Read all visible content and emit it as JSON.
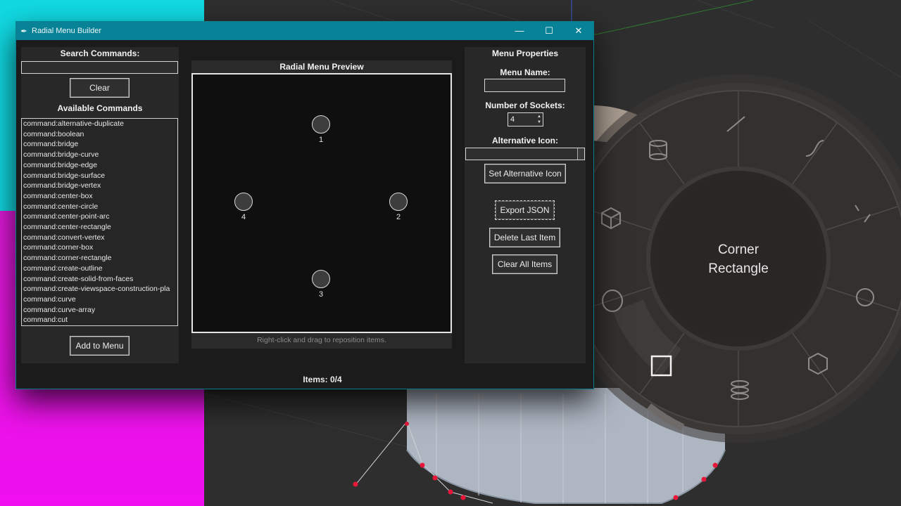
{
  "window": {
    "title": "Radial Menu Builder",
    "controls": {
      "minimize": "—",
      "maximize": "☐",
      "close": "✕"
    }
  },
  "left": {
    "search_label": "Search Commands:",
    "search_value": "",
    "clear_label": "Clear",
    "available_label": "Available Commands",
    "commands": [
      "command:alternative-duplicate",
      "command:boolean",
      "command:bridge",
      "command:bridge-curve",
      "command:bridge-edge",
      "command:bridge-surface",
      "command:bridge-vertex",
      "command:center-box",
      "command:center-circle",
      "command:center-point-arc",
      "command:center-rectangle",
      "command:convert-vertex",
      "command:corner-box",
      "command:corner-rectangle",
      "command:create-outline",
      "command:create-solid-from-faces",
      "command:create-viewspace-construction-pla",
      "command:curve",
      "command:curve-array",
      "command:cut"
    ],
    "add_label": "Add to Menu"
  },
  "center": {
    "preview_label": "Radial Menu Preview",
    "sockets": [
      "1",
      "2",
      "3",
      "4"
    ],
    "hint": "Right-click and drag to reposition items."
  },
  "right": {
    "properties_label": "Menu Properties",
    "menu_name_label": "Menu Name:",
    "menu_name_value": "",
    "sockets_label": "Number of Sockets:",
    "sockets_value": "4",
    "alt_icon_label": "Alternative Icon:",
    "alt_icon_value": "",
    "set_alt_icon_label": "Set Alternative Icon",
    "export_label": "Export JSON",
    "delete_last_label": "Delete Last Item",
    "clear_all_label": "Clear All Items"
  },
  "status": {
    "items": "Items: 0/4"
  },
  "radial_menu": {
    "center_line1": "Corner",
    "center_line2": "Rectangle",
    "icons": [
      "line-icon",
      "curve-icon",
      "bridge-curve-icon",
      "circle-point-icon",
      "hexagon-icon",
      "stack-icon",
      "corner-rectangle-icon",
      "circle-icon",
      "box-icon",
      "cylinder-icon"
    ]
  }
}
